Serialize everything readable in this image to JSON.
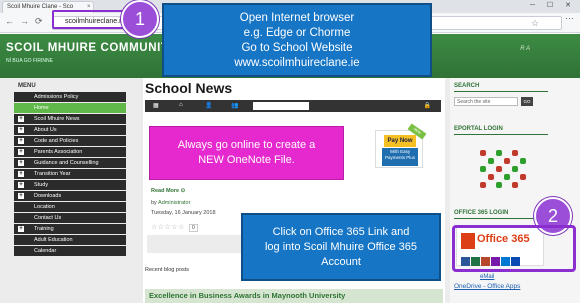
{
  "browser": {
    "tab_title": "Scoil Mhuire Clane - Sco",
    "tab_close": "×",
    "window_controls": "─ ☐ ✕",
    "back": "←",
    "forward": "→",
    "refresh": "⟳",
    "url": "scoilmhuireclane.ie",
    "star": "☆",
    "menu": "⋯"
  },
  "site": {
    "school_name": "SCOIL MHUIRE COMMUNITY",
    "motto": "NÍ BUA GO FIRINNE",
    "header_deco": "R  A"
  },
  "sidebar": {
    "title": "MENU",
    "items": [
      {
        "label": "Admissions Policy",
        "expandable": false,
        "active": false
      },
      {
        "label": "Home",
        "expandable": false,
        "active": true
      },
      {
        "label": "Scoil Mhuire News",
        "expandable": true,
        "active": false
      },
      {
        "label": "About Us",
        "expandable": true,
        "active": false
      },
      {
        "label": "Code and Policies",
        "expandable": true,
        "active": false
      },
      {
        "label": "Parents Association",
        "expandable": true,
        "active": false
      },
      {
        "label": "Guidance and Counselling",
        "expandable": true,
        "active": false
      },
      {
        "label": "Transition Year",
        "expandable": true,
        "active": false
      },
      {
        "label": "Study",
        "expandable": true,
        "active": false
      },
      {
        "label": "Downloads",
        "expandable": true,
        "active": false
      },
      {
        "label": "Location",
        "expandable": false,
        "active": false
      },
      {
        "label": "Contact Us",
        "expandable": false,
        "active": false
      },
      {
        "label": "Training",
        "expandable": true,
        "active": false
      },
      {
        "label": "Adult Education",
        "expandable": false,
        "active": false
      },
      {
        "label": "Calendar",
        "expandable": false,
        "active": false
      }
    ]
  },
  "main": {
    "title": "School News",
    "toolbar_icons": [
      "▦",
      "⌂",
      "👤",
      "👥"
    ],
    "lock": "🔒",
    "paypal_main": "Pay Now",
    "paypal_sub": "With Easy Payments Plus",
    "paypal_ribbon": "NEW",
    "read_more": "Read More",
    "read_more_icon": "⊙",
    "by_prefix": "by",
    "author": "Administrator",
    "date": "Tuesday, 16 January 2018",
    "stars": "☆☆☆☆☆",
    "rating_count": "0",
    "recent_posts": "Recent blog posts",
    "excellence_title": "Excellence in Business Awards in Maynooth University"
  },
  "right": {
    "search_heading": "SEARCH",
    "search_placeholder": "Search the site",
    "search_go": "GO",
    "eportal_heading": "EPORTAL LOGIN",
    "office_heading": "OFFICE 365 LOGIN",
    "office_text": "Office 365",
    "email_link": "eMail",
    "onedrive_link": "OneDrive - Office Apps"
  },
  "callouts": {
    "browser": "Open Internet browser\ne.g. Edge or Chorme\nGo to School Website\nwww.scoilmhuireclane.ie",
    "onenote": "Always go online to create a\nNEW OneNote File.",
    "office": "Click on Office 365 Link and\nlog into Scoil Mhuire Office 365\nAccount",
    "badge1": "1",
    "badge2": "2"
  },
  "colors": {
    "brand_green": "#2f7336",
    "callout_blue": "#1675c5",
    "callout_pink": "#e529ce",
    "badge_purple": "#9b4fd8",
    "office_red": "#dc3e15"
  }
}
